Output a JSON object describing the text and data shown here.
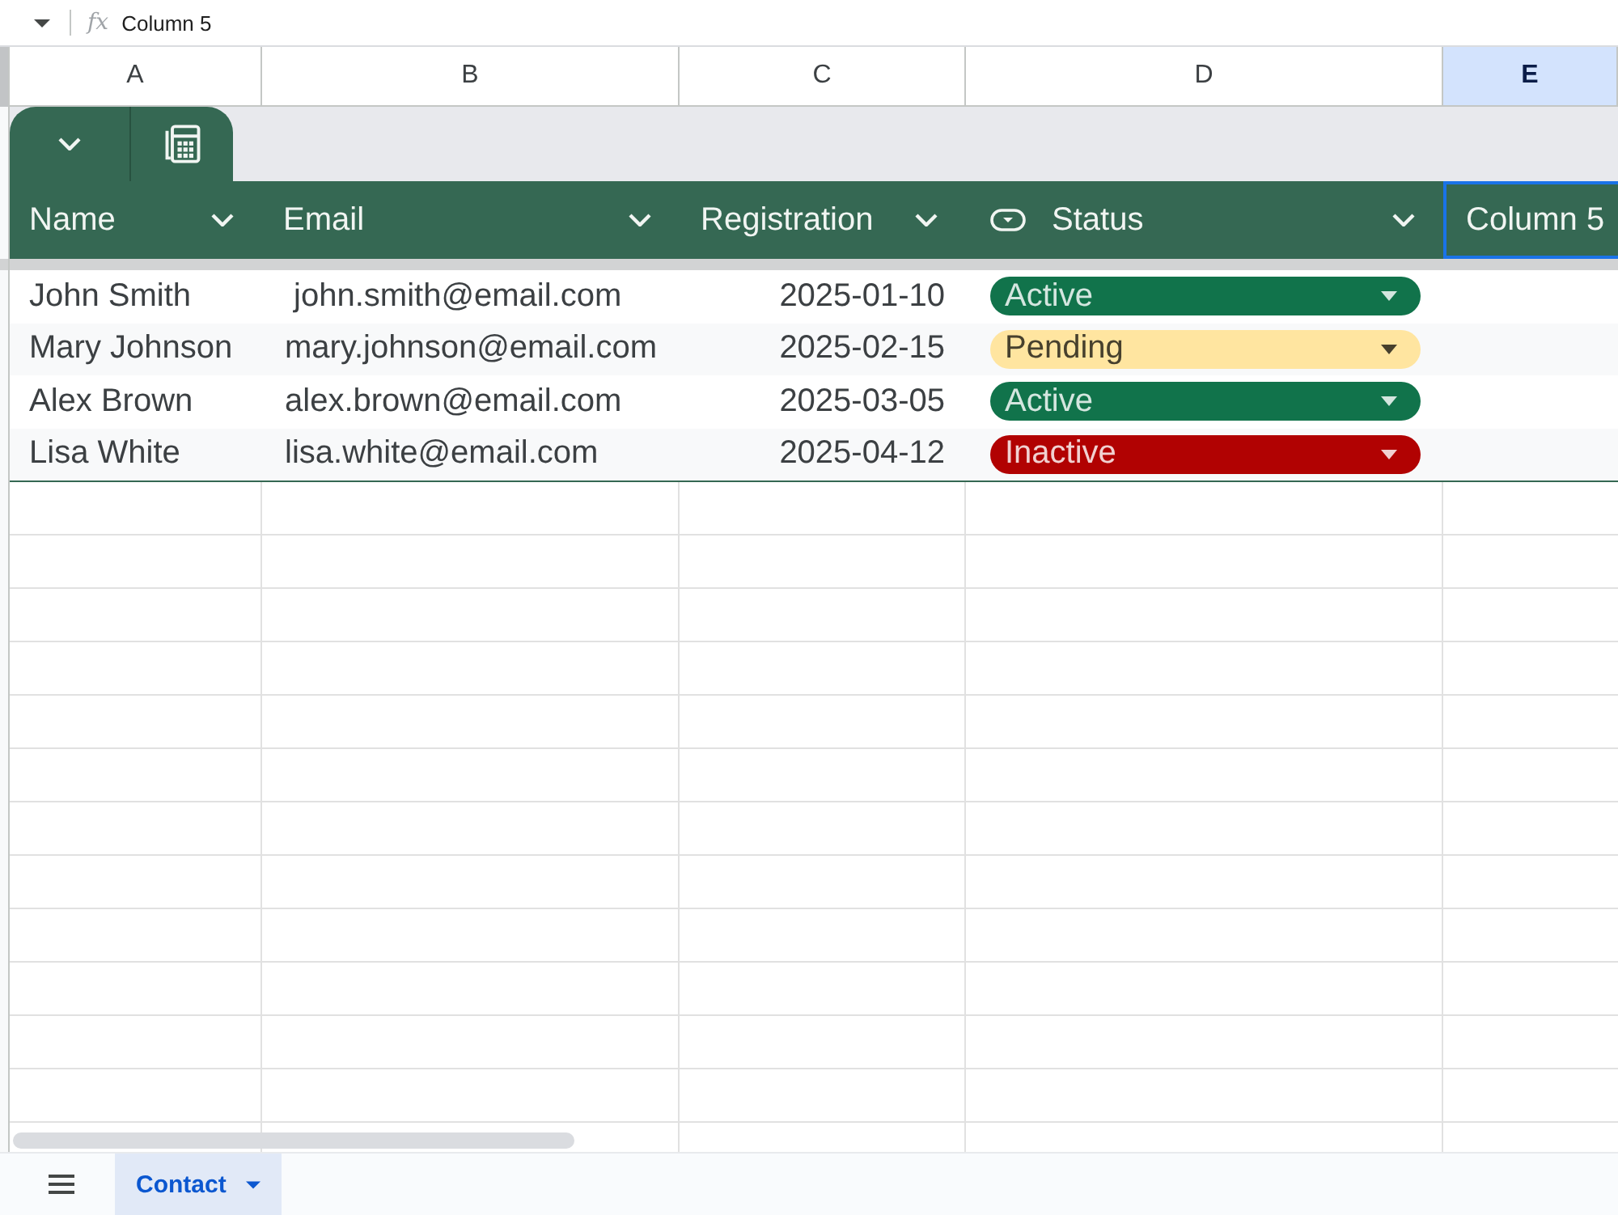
{
  "formula_bar": {
    "function_label": "fx",
    "value": "Column 5"
  },
  "column_headers": [
    {
      "label": "A",
      "selected": false
    },
    {
      "label": "B",
      "selected": false
    },
    {
      "label": "C",
      "selected": false
    },
    {
      "label": "D",
      "selected": false
    },
    {
      "label": "E",
      "selected": true
    }
  ],
  "table": {
    "columns": [
      {
        "label": "Name",
        "kind": "filter",
        "selected": false
      },
      {
        "label": "Email",
        "kind": "filter",
        "selected": false
      },
      {
        "label": "Registration",
        "kind": "filter",
        "selected": false
      },
      {
        "label": "Status",
        "kind": "dropdown",
        "selected": false
      },
      {
        "label": "Column 5",
        "kind": "plain",
        "selected": true
      }
    ],
    "rows": [
      {
        "name": "John Smith",
        "email": " john.smith@email.com",
        "registration_date": "2025-01-10",
        "status": {
          "label": "Active",
          "color": "#11734b"
        }
      },
      {
        "name": "Mary Johnson",
        "email": "mary.johnson@email.com",
        "registration_date": "2025-02-15",
        "status": {
          "label": "Pending",
          "color": "#ffe5a0"
        }
      },
      {
        "name": "Alex Brown",
        "email": "alex.brown@email.com",
        "registration_date": "2025-03-05",
        "status": {
          "label": "Active",
          "color": "#11734b"
        }
      },
      {
        "name": "Lisa White",
        "email": "lisa.white@email.com",
        "registration_date": "2025-04-12",
        "status": {
          "label": "Inactive",
          "color": "#b10202"
        }
      }
    ]
  },
  "sheet_tabs": [
    {
      "label": "Contact",
      "selected": true
    }
  ]
}
